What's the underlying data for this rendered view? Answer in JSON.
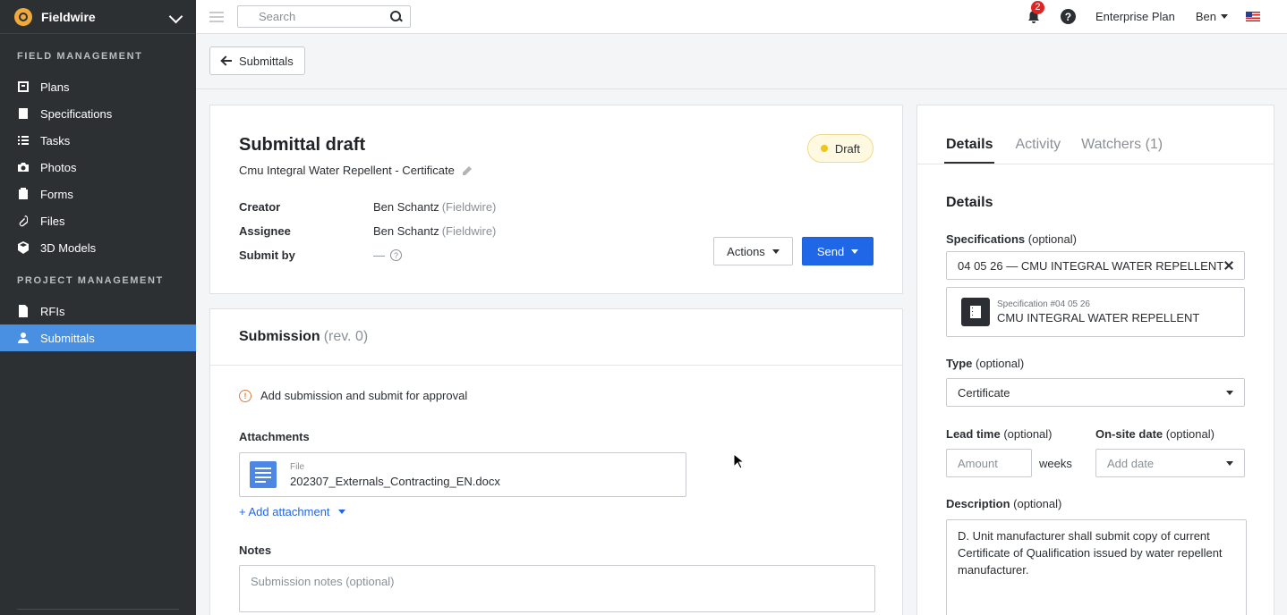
{
  "app": {
    "brand": "Fieldwire"
  },
  "sidebar": {
    "section1": "FIELD MANAGEMENT",
    "section2": "PROJECT MANAGEMENT",
    "items": [
      {
        "label": "Plans",
        "icon": "plans-icon"
      },
      {
        "label": "Specifications",
        "icon": "specifications-icon"
      },
      {
        "label": "Tasks",
        "icon": "tasks-icon"
      },
      {
        "label": "Photos",
        "icon": "camera-icon"
      },
      {
        "label": "Forms",
        "icon": "forms-icon"
      },
      {
        "label": "Files",
        "icon": "paperclip-icon"
      },
      {
        "label": "3D Models",
        "icon": "cube-icon"
      }
    ],
    "pm_items": [
      {
        "label": "RFIs",
        "icon": "rfi-icon"
      },
      {
        "label": "Submittals",
        "icon": "submittals-icon",
        "active": true
      }
    ]
  },
  "topbar": {
    "search_placeholder": "Search",
    "notification_count": "2",
    "help": "?",
    "plan": "Enterprise Plan",
    "user": "Ben"
  },
  "subheader": {
    "back_label": "Submittals"
  },
  "draft": {
    "title": "Submittal draft",
    "subtitle": "Cmu Integral Water Repellent - Certificate",
    "status": "Draft",
    "creator_label": "Creator",
    "creator_name": "Ben Schantz",
    "creator_org": "(Fieldwire)",
    "assignee_label": "Assignee",
    "assignee_name": "Ben Schantz",
    "assignee_org": "(Fieldwire)",
    "submit_by_label": "Submit by",
    "submit_by_value": "—",
    "actions_label": "Actions",
    "send_label": "Send"
  },
  "submission": {
    "title": "Submission",
    "rev": "(rev. 0)",
    "warning": "Add submission and submit for approval",
    "attachments_label": "Attachments",
    "file_type": "File",
    "file_name": "202307_Externals_Contracting_EN.docx",
    "add_attachment": "+ Add attachment",
    "notes_label": "Notes",
    "notes_placeholder": "Submission notes (optional)"
  },
  "details": {
    "tabs": [
      "Details",
      "Activity",
      "Watchers (1)"
    ],
    "heading": "Details",
    "spec_label": "Specifications",
    "spec_opt": "(optional)",
    "spec_value": "04 05 26 — CMU INTEGRAL WATER REPELLENT",
    "spec_card_small": "Specification #04 05 26",
    "spec_card_name": "CMU INTEGRAL WATER REPELLENT",
    "type_label": "Type",
    "type_opt": "(optional)",
    "type_value": "Certificate",
    "lead_label": "Lead time",
    "lead_opt": "(optional)",
    "lead_placeholder": "Amount",
    "weeks": "weeks",
    "onsite_label": "On-site date",
    "onsite_opt": "(optional)",
    "onsite_placeholder": "Add date",
    "desc_label": "Description",
    "desc_opt": "(optional)",
    "desc_value": "D. Unit manufacturer shall submit copy of current Certificate of Qualification issued by water repellent manufacturer."
  }
}
